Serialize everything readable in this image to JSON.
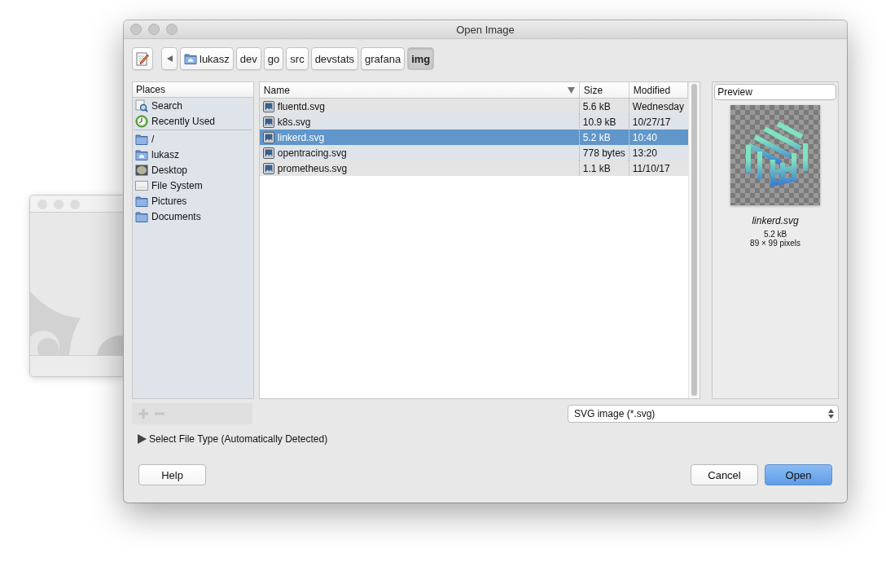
{
  "window": {
    "title": "Open Image"
  },
  "toolbar": {
    "path": [
      {
        "label": "lukasz",
        "kind": "home",
        "selected": false
      },
      {
        "label": "dev",
        "kind": "plain",
        "selected": false
      },
      {
        "label": "go",
        "kind": "plain",
        "selected": false
      },
      {
        "label": "src",
        "kind": "plain",
        "selected": false
      },
      {
        "label": "devstats",
        "kind": "plain",
        "selected": false
      },
      {
        "label": "grafana",
        "kind": "plain",
        "selected": false
      },
      {
        "label": "img",
        "kind": "plain",
        "selected": true
      }
    ]
  },
  "places": {
    "header": "Places",
    "groups": [
      [
        {
          "label": "Search",
          "kind": "search"
        },
        {
          "label": "Recently Used",
          "kind": "recent"
        }
      ],
      [
        {
          "label": "/",
          "kind": "folder"
        },
        {
          "label": "lukasz",
          "kind": "home"
        },
        {
          "label": "Desktop",
          "kind": "desktop"
        },
        {
          "label": "File System",
          "kind": "drive"
        },
        {
          "label": "Pictures",
          "kind": "folder"
        },
        {
          "label": "Documents",
          "kind": "folder"
        }
      ]
    ]
  },
  "files": {
    "columns": [
      "Name",
      "Size",
      "Modified"
    ],
    "rows": [
      {
        "name": "fluentd.svg",
        "size": "5.6 kB",
        "modified": "Wednesday",
        "selected": false
      },
      {
        "name": "k8s.svg",
        "size": "10.9 kB",
        "modified": "10/27/17",
        "selected": false
      },
      {
        "name": "linkerd.svg",
        "size": "5.2 kB",
        "modified": "10:40",
        "selected": true
      },
      {
        "name": "opentracing.svg",
        "size": "778 bytes",
        "modified": "13:20",
        "selected": false
      },
      {
        "name": "prometheus.svg",
        "size": "1.1 kB",
        "modified": "11/10/17",
        "selected": false
      }
    ]
  },
  "preview": {
    "header": "Preview",
    "filename": "linkerd.svg",
    "size": "5.2 kB",
    "dimensions": "89 × 99 pixels"
  },
  "filter": {
    "value": "SVG image (*.svg)"
  },
  "expander": {
    "label": "Select File Type (Automatically Detected)",
    "expanded": false
  },
  "buttons": [
    {
      "label": "Help",
      "kind": "normal"
    },
    {
      "label": "Cancel",
      "kind": "normal"
    },
    {
      "label": "Open",
      "kind": "primary"
    }
  ]
}
